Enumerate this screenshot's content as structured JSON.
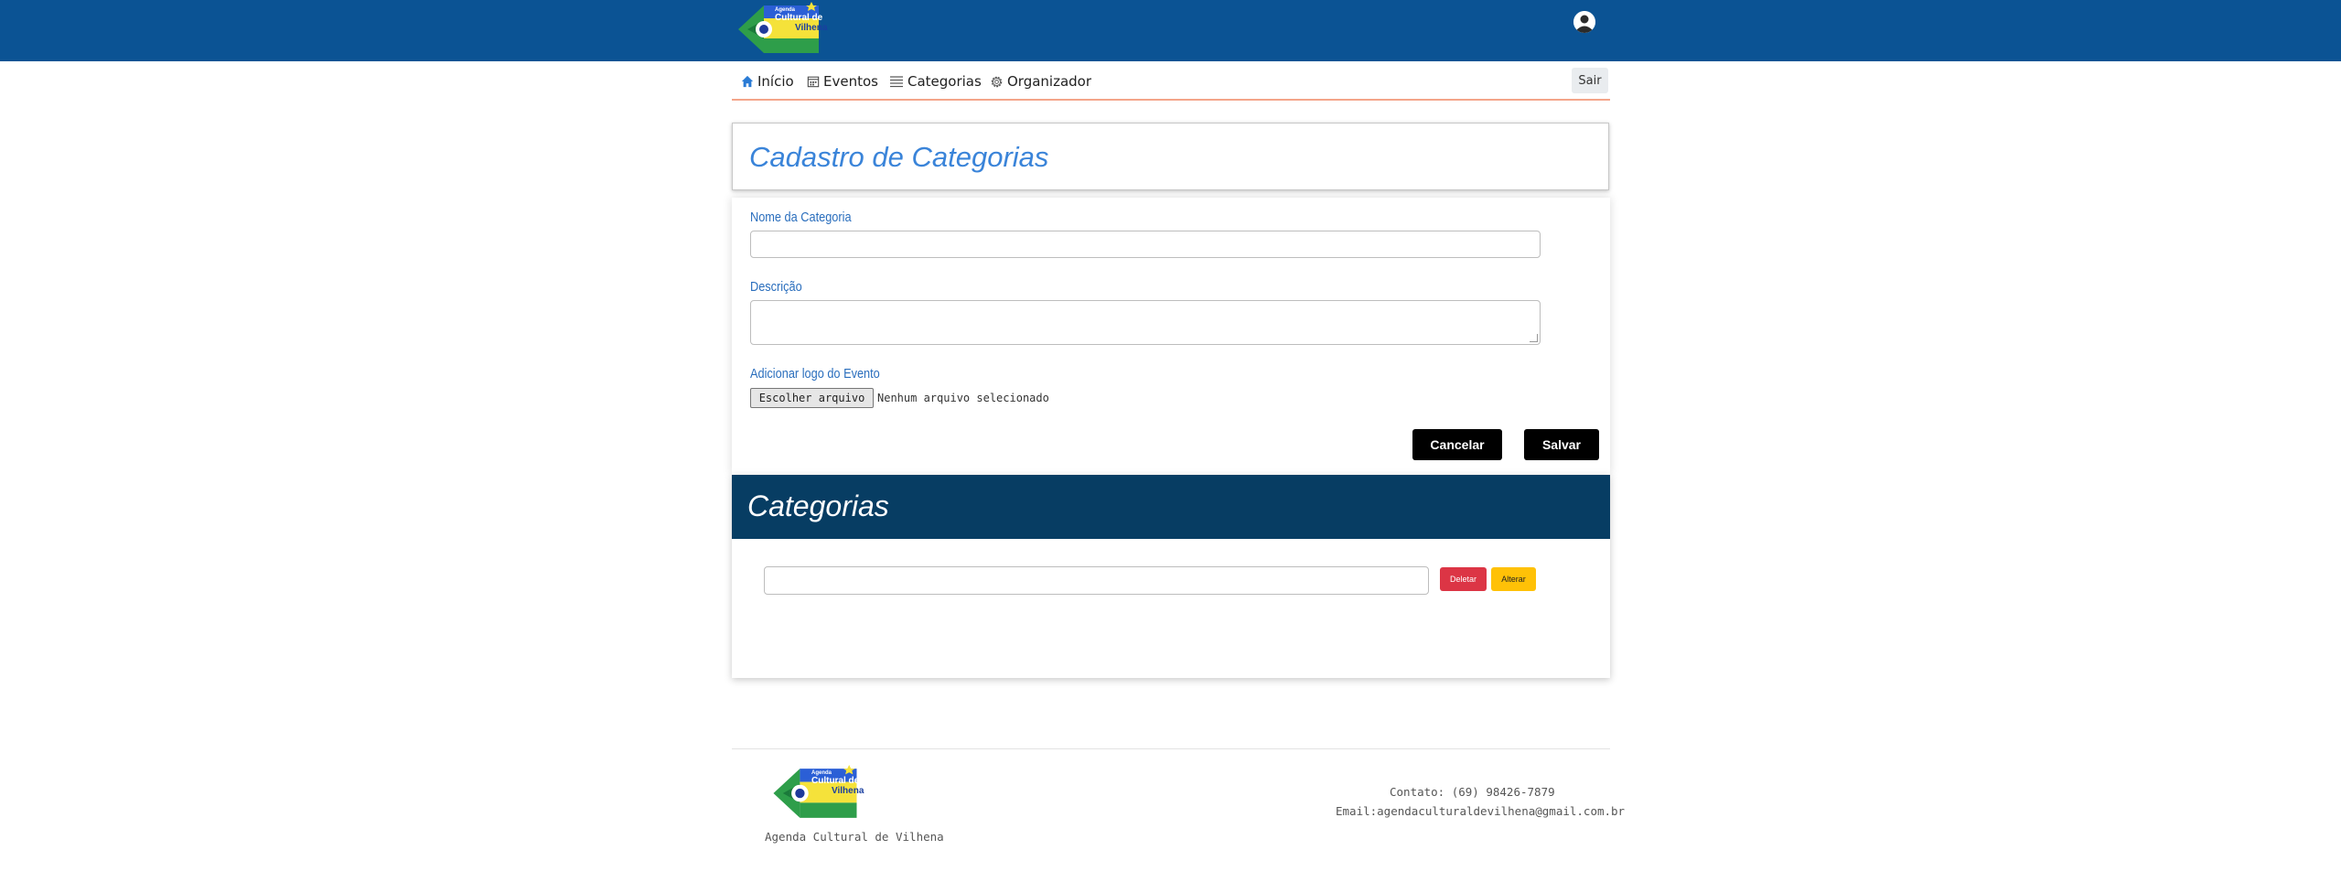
{
  "header": {
    "logo": {
      "small_text": "Agenda",
      "main_text_1": "Cultural de",
      "main_text_2": "Vilhena"
    },
    "user_icon": "user-avatar-icon"
  },
  "nav": {
    "items": [
      {
        "label": "Início",
        "icon": "home-icon"
      },
      {
        "label": "Eventos",
        "icon": "calendar-icon"
      },
      {
        "label": "Categorias",
        "icon": "list-icon"
      },
      {
        "label": "Organizador",
        "icon": "gear-icon"
      }
    ],
    "logout_label": "Sair"
  },
  "page_title": "Cadastro de Categorias",
  "form": {
    "name_label": "Nome da Categoria",
    "name_value": "",
    "description_label": "Descrição",
    "description_value": "",
    "logo_label": "Adicionar logo do Evento",
    "file_button": "Escolher arquivo",
    "file_status": "Nenhum arquivo selecionado",
    "cancel_label": "Cancelar",
    "save_label": "Salvar"
  },
  "list": {
    "title": "Categorias",
    "rows": [
      {
        "value": "",
        "delete_label": "Deletar",
        "edit_label": "Alterar"
      }
    ]
  },
  "footer": {
    "site_name": "Agenda Cultural de Vilhena",
    "contact": "Contato: (69) 98426-7879",
    "email": "Email:agendaculturaldevilhena@gmail.com.br"
  },
  "colors": {
    "topbar": "#0b5394",
    "accent_blue": "#3a84d9",
    "list_header": "#073d63",
    "delete": "#dc3545",
    "edit": "#ffc107"
  }
}
